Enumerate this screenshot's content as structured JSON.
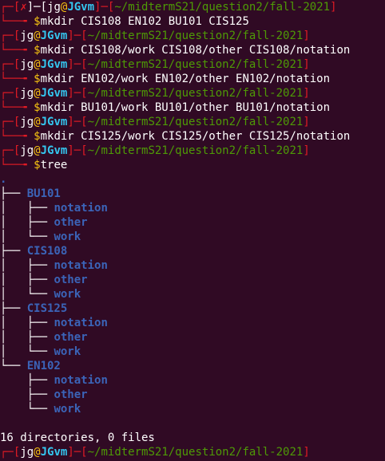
{
  "colors": {
    "background": "#300a24",
    "prompt_bracket": "#e01b24",
    "host": "#34c6ef",
    "path": "#4e9a06",
    "dollar": "#f5c211",
    "directory": "#3b64b8",
    "text": "#ffffff"
  },
  "prompt": {
    "user": "jg",
    "at": "@",
    "host": "JGvm",
    "path": "~/midtermS21/question2/fall-2021",
    "error_mark": "✗",
    "dollar": "$"
  },
  "commands": [
    "mkdir CIS108 EN102 BU101 CIS125",
    "mkdir CIS108/work CIS108/other CIS108/notation",
    "mkdir EN102/work EN102/other EN102/notation",
    "mkdir BU101/work BU101/other BU101/notation",
    "mkdir CIS125/work CIS125/other CIS125/notation",
    "tree"
  ],
  "tree": {
    "root": ".",
    "dirs": [
      {
        "name": "BU101",
        "children": [
          "notation",
          "other",
          "work"
        ]
      },
      {
        "name": "CIS108",
        "children": [
          "notation",
          "other",
          "work"
        ]
      },
      {
        "name": "CIS125",
        "children": [
          "notation",
          "other",
          "work"
        ]
      },
      {
        "name": "EN102",
        "children": [
          "notation",
          "other",
          "work"
        ]
      }
    ],
    "summary": "16 directories, 0 files"
  }
}
